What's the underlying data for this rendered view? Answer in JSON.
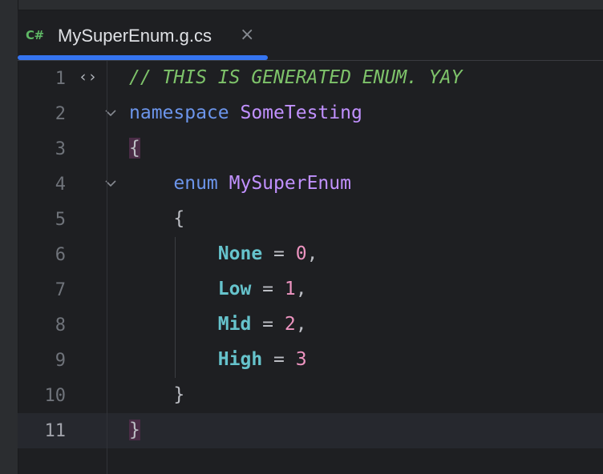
{
  "tab": {
    "lang_badge": "C#",
    "title": "MySuperEnum.g.cs",
    "close_glyph": "×"
  },
  "code_lines": [
    {
      "number": "1",
      "tokens": [
        {
          "t": "// THIS IS GENERATED ENUM. YAY",
          "c": "tok-comment"
        }
      ],
      "gutter_icon": "⟨⟩"
    },
    {
      "number": "2",
      "tokens": [
        {
          "t": "namespace",
          "c": "tok-keyword"
        },
        {
          "t": " ",
          "c": "tok-punct"
        },
        {
          "t": "SomeTesting",
          "c": "tok-ns"
        }
      ],
      "fold": true
    },
    {
      "number": "3",
      "tokens": [
        {
          "t": "{",
          "c": "tok-punct tok-brace-hl"
        }
      ]
    },
    {
      "number": "4",
      "tokens": [
        {
          "t": "    ",
          "c": "tok-punct"
        },
        {
          "t": "enum",
          "c": "tok-keyword"
        },
        {
          "t": " ",
          "c": "tok-punct"
        },
        {
          "t": "MySuperEnum",
          "c": "tok-type"
        }
      ],
      "fold": true
    },
    {
      "number": "5",
      "tokens": [
        {
          "t": "    {",
          "c": "tok-punct"
        }
      ]
    },
    {
      "number": "6",
      "tokens": [
        {
          "t": "        ",
          "c": "tok-punct"
        },
        {
          "t": "None",
          "c": "tok-member"
        },
        {
          "t": " = ",
          "c": "tok-punct"
        },
        {
          "t": "0",
          "c": "tok-number"
        },
        {
          "t": ",",
          "c": "tok-punct"
        }
      ]
    },
    {
      "number": "7",
      "tokens": [
        {
          "t": "        ",
          "c": "tok-punct"
        },
        {
          "t": "Low",
          "c": "tok-member"
        },
        {
          "t": " = ",
          "c": "tok-punct"
        },
        {
          "t": "1",
          "c": "tok-number"
        },
        {
          "t": ",",
          "c": "tok-punct"
        }
      ]
    },
    {
      "number": "8",
      "tokens": [
        {
          "t": "        ",
          "c": "tok-punct"
        },
        {
          "t": "Mid",
          "c": "tok-member"
        },
        {
          "t": " = ",
          "c": "tok-punct"
        },
        {
          "t": "2",
          "c": "tok-number"
        },
        {
          "t": ",",
          "c": "tok-punct"
        }
      ]
    },
    {
      "number": "9",
      "tokens": [
        {
          "t": "        ",
          "c": "tok-punct"
        },
        {
          "t": "High",
          "c": "tok-member"
        },
        {
          "t": " = ",
          "c": "tok-punct"
        },
        {
          "t": "3",
          "c": "tok-number"
        }
      ]
    },
    {
      "number": "10",
      "tokens": [
        {
          "t": "    }",
          "c": "tok-punct"
        }
      ]
    },
    {
      "number": "11",
      "tokens": [
        {
          "t": "}",
          "c": "tok-punct tok-brace-hl"
        }
      ],
      "current": true
    }
  ],
  "colors": {
    "background": "#1e1f22",
    "tab_underline": "#3574f0",
    "comment": "#7ec36a",
    "keyword": "#6c95eb",
    "type": "#c191ff",
    "enum_member": "#66c3cc",
    "number": "#ed94c0"
  },
  "icons": {
    "lang_badge": "csharp-icon",
    "close": "close-icon",
    "fold": "chevron-down-icon",
    "gutter_line1": "code-structure-icon"
  }
}
